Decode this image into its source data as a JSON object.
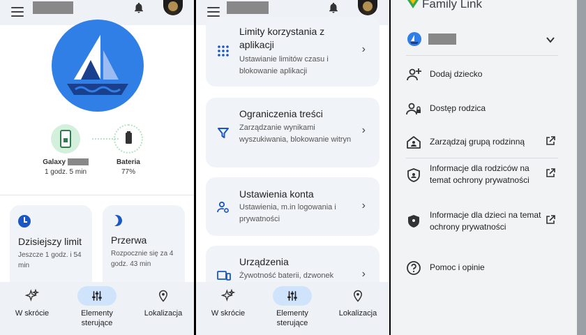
{
  "panel1": {
    "devices": [
      {
        "name": "Galaxy",
        "time": "1 godz. 5 min"
      },
      {
        "name": "Bateria",
        "value": "77%"
      }
    ],
    "cards": [
      {
        "title": "Dzisiejszy limit",
        "subtitle": "Jeszcze 1 godz. i 54 min"
      },
      {
        "title": "Przerwa",
        "subtitle": "Rozpocznie się za 4 godz. 43 min"
      }
    ]
  },
  "bottom_nav": {
    "items": [
      {
        "label": "W skrócie",
        "icon": "sparkle-icon"
      },
      {
        "label": "Elementy sterujące",
        "icon": "sliders-icon",
        "active": true
      },
      {
        "label": "Lokalizacja",
        "icon": "location-icon"
      }
    ]
  },
  "panel2": {
    "items": [
      {
        "title": "Limity korzystania z aplikacji",
        "desc": "Ustawianie limitów czasu i blokowanie aplikacji",
        "icon": "apps-grid-icon"
      },
      {
        "title": "Ograniczenia treści",
        "desc": "Zarządzanie wynikami wyszukiwania, blokowanie witryn",
        "icon": "filter-icon"
      },
      {
        "title": "Ustawienia konta",
        "desc": "Ustawienia, m.in logowania i prywatności",
        "icon": "account-settings-icon"
      },
      {
        "title": "Urządzenia",
        "desc": "Żywotność baterii, dzwonek",
        "icon": "devices-icon"
      }
    ]
  },
  "panel3": {
    "app_title": "Family Link",
    "menu": [
      {
        "label": "Dodaj dziecko",
        "icon": "add-person-icon",
        "external": false
      },
      {
        "label": "Dostęp rodzica",
        "icon": "parent-access-icon",
        "external": false
      },
      {
        "label": "Zarządzaj grupą rodzinną",
        "icon": "family-home-icon",
        "external": true
      },
      {
        "label": "Informacje dla rodziców na temat ochrony prywatności",
        "icon": "privacy-shield-icon",
        "external": true
      },
      {
        "label": "Informacje dla dzieci na temat ochrony prywatności",
        "icon": "privacy-shield-icon",
        "external": true
      },
      {
        "label": "Pomoc i opinie",
        "icon": "help-icon",
        "external": false
      }
    ]
  },
  "colors": {
    "accent": "#1a56c4",
    "hero_blue": "#2f7fe6",
    "device_green": "#d3f0dd",
    "nav_pill": "#cfe3fb"
  }
}
